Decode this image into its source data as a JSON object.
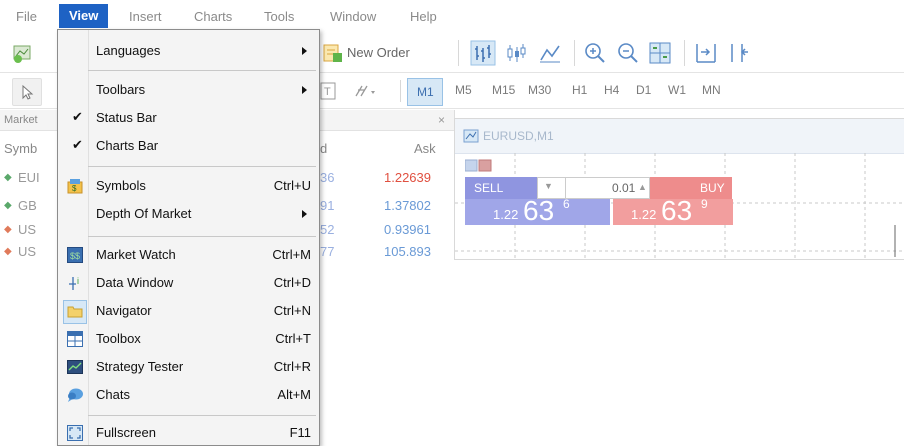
{
  "menubar": {
    "items": [
      "File",
      "View",
      "Insert",
      "Charts",
      "Tools",
      "Window",
      "Help"
    ],
    "active": "View"
  },
  "toolbar": {
    "new_order_label": "New Order",
    "timeframes": [
      "M1",
      "M5",
      "M15",
      "M30",
      "H1",
      "H4",
      "D1",
      "W1",
      "MN"
    ]
  },
  "market_watch": {
    "title": "Market",
    "close_glyph": "×",
    "col_symbol": "Symb",
    "col_bid_fragment": "d",
    "col_ask": "Ask",
    "rows": [
      {
        "symbol": "EUI",
        "bid_fragment": "36",
        "ask": "1.22639",
        "dir": "up"
      },
      {
        "symbol": "GB",
        "bid_fragment": "91",
        "ask": "1.37802",
        "dir": "up"
      },
      {
        "symbol": "US",
        "bid_fragment": "52",
        "ask": "0.93961",
        "dir": "down"
      },
      {
        "symbol": "US",
        "bid_fragment": "77",
        "ask": "105.893",
        "dir": "down"
      }
    ]
  },
  "chart": {
    "title": "EURUSD,M1",
    "sell_label": "SELL",
    "buy_label": "BUY",
    "lot_value": "0.01",
    "sell_price_prefix": "1.22",
    "sell_price_big": "63",
    "sell_price_sup": "6",
    "buy_price_prefix": "1.22",
    "buy_price_big": "63",
    "buy_price_sup": "9"
  },
  "view_menu": {
    "items": [
      {
        "label": "Languages",
        "shortcut": "",
        "submenu": true,
        "checked": false,
        "icon": ""
      },
      {
        "label": "Toolbars",
        "shortcut": "",
        "submenu": true,
        "checked": false,
        "icon": ""
      },
      {
        "label": "Status Bar",
        "shortcut": "",
        "submenu": false,
        "checked": true,
        "icon": ""
      },
      {
        "label": "Charts Bar",
        "shortcut": "",
        "submenu": false,
        "checked": true,
        "icon": ""
      },
      {
        "label": "Symbols",
        "shortcut": "Ctrl+U",
        "submenu": false,
        "checked": false,
        "icon": "symbols-icon"
      },
      {
        "label": "Depth Of Market",
        "shortcut": "",
        "submenu": true,
        "checked": false,
        "icon": ""
      },
      {
        "label": "Market Watch",
        "shortcut": "Ctrl+M",
        "submenu": false,
        "checked": false,
        "icon": "market-watch-icon"
      },
      {
        "label": "Data Window",
        "shortcut": "Ctrl+D",
        "submenu": false,
        "checked": false,
        "icon": "data-window-icon"
      },
      {
        "label": "Navigator",
        "shortcut": "Ctrl+N",
        "submenu": false,
        "checked": false,
        "icon": "navigator-icon"
      },
      {
        "label": "Toolbox",
        "shortcut": "Ctrl+T",
        "submenu": false,
        "checked": false,
        "icon": "toolbox-icon"
      },
      {
        "label": "Strategy Tester",
        "shortcut": "Ctrl+R",
        "submenu": false,
        "checked": false,
        "icon": "strategy-tester-icon"
      },
      {
        "label": "Chats",
        "shortcut": "Alt+M",
        "submenu": false,
        "checked": false,
        "icon": "chats-icon"
      },
      {
        "label": "Fullscreen",
        "shortcut": "F11",
        "submenu": false,
        "checked": false,
        "icon": "fullscreen-icon"
      }
    ],
    "check_glyph": "✔"
  },
  "colors": {
    "accent": "#1e62c4",
    "sell": "#8f95e0",
    "buy": "#ee8c8c",
    "up_arrow": "#5aa86a",
    "down_arrow": "#e07a5a",
    "ask_price": "#e05040"
  }
}
